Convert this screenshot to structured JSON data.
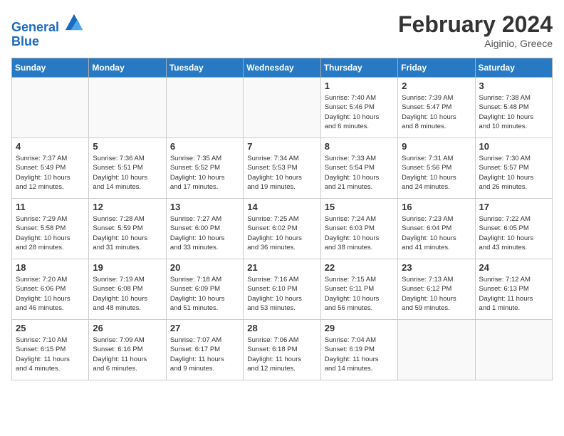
{
  "header": {
    "logo_line1": "General",
    "logo_line2": "Blue",
    "month_title": "February 2024",
    "location": "Aiginio, Greece"
  },
  "weekdays": [
    "Sunday",
    "Monday",
    "Tuesday",
    "Wednesday",
    "Thursday",
    "Friday",
    "Saturday"
  ],
  "weeks": [
    [
      {
        "day": "",
        "info": ""
      },
      {
        "day": "",
        "info": ""
      },
      {
        "day": "",
        "info": ""
      },
      {
        "day": "",
        "info": ""
      },
      {
        "day": "1",
        "info": "Sunrise: 7:40 AM\nSunset: 5:46 PM\nDaylight: 10 hours\nand 6 minutes."
      },
      {
        "day": "2",
        "info": "Sunrise: 7:39 AM\nSunset: 5:47 PM\nDaylight: 10 hours\nand 8 minutes."
      },
      {
        "day": "3",
        "info": "Sunrise: 7:38 AM\nSunset: 5:48 PM\nDaylight: 10 hours\nand 10 minutes."
      }
    ],
    [
      {
        "day": "4",
        "info": "Sunrise: 7:37 AM\nSunset: 5:49 PM\nDaylight: 10 hours\nand 12 minutes."
      },
      {
        "day": "5",
        "info": "Sunrise: 7:36 AM\nSunset: 5:51 PM\nDaylight: 10 hours\nand 14 minutes."
      },
      {
        "day": "6",
        "info": "Sunrise: 7:35 AM\nSunset: 5:52 PM\nDaylight: 10 hours\nand 17 minutes."
      },
      {
        "day": "7",
        "info": "Sunrise: 7:34 AM\nSunset: 5:53 PM\nDaylight: 10 hours\nand 19 minutes."
      },
      {
        "day": "8",
        "info": "Sunrise: 7:33 AM\nSunset: 5:54 PM\nDaylight: 10 hours\nand 21 minutes."
      },
      {
        "day": "9",
        "info": "Sunrise: 7:31 AM\nSunset: 5:56 PM\nDaylight: 10 hours\nand 24 minutes."
      },
      {
        "day": "10",
        "info": "Sunrise: 7:30 AM\nSunset: 5:57 PM\nDaylight: 10 hours\nand 26 minutes."
      }
    ],
    [
      {
        "day": "11",
        "info": "Sunrise: 7:29 AM\nSunset: 5:58 PM\nDaylight: 10 hours\nand 28 minutes."
      },
      {
        "day": "12",
        "info": "Sunrise: 7:28 AM\nSunset: 5:59 PM\nDaylight: 10 hours\nand 31 minutes."
      },
      {
        "day": "13",
        "info": "Sunrise: 7:27 AM\nSunset: 6:00 PM\nDaylight: 10 hours\nand 33 minutes."
      },
      {
        "day": "14",
        "info": "Sunrise: 7:25 AM\nSunset: 6:02 PM\nDaylight: 10 hours\nand 36 minutes."
      },
      {
        "day": "15",
        "info": "Sunrise: 7:24 AM\nSunset: 6:03 PM\nDaylight: 10 hours\nand 38 minutes."
      },
      {
        "day": "16",
        "info": "Sunrise: 7:23 AM\nSunset: 6:04 PM\nDaylight: 10 hours\nand 41 minutes."
      },
      {
        "day": "17",
        "info": "Sunrise: 7:22 AM\nSunset: 6:05 PM\nDaylight: 10 hours\nand 43 minutes."
      }
    ],
    [
      {
        "day": "18",
        "info": "Sunrise: 7:20 AM\nSunset: 6:06 PM\nDaylight: 10 hours\nand 46 minutes."
      },
      {
        "day": "19",
        "info": "Sunrise: 7:19 AM\nSunset: 6:08 PM\nDaylight: 10 hours\nand 48 minutes."
      },
      {
        "day": "20",
        "info": "Sunrise: 7:18 AM\nSunset: 6:09 PM\nDaylight: 10 hours\nand 51 minutes."
      },
      {
        "day": "21",
        "info": "Sunrise: 7:16 AM\nSunset: 6:10 PM\nDaylight: 10 hours\nand 53 minutes."
      },
      {
        "day": "22",
        "info": "Sunrise: 7:15 AM\nSunset: 6:11 PM\nDaylight: 10 hours\nand 56 minutes."
      },
      {
        "day": "23",
        "info": "Sunrise: 7:13 AM\nSunset: 6:12 PM\nDaylight: 10 hours\nand 59 minutes."
      },
      {
        "day": "24",
        "info": "Sunrise: 7:12 AM\nSunset: 6:13 PM\nDaylight: 11 hours\nand 1 minute."
      }
    ],
    [
      {
        "day": "25",
        "info": "Sunrise: 7:10 AM\nSunset: 6:15 PM\nDaylight: 11 hours\nand 4 minutes."
      },
      {
        "day": "26",
        "info": "Sunrise: 7:09 AM\nSunset: 6:16 PM\nDaylight: 11 hours\nand 6 minutes."
      },
      {
        "day": "27",
        "info": "Sunrise: 7:07 AM\nSunset: 6:17 PM\nDaylight: 11 hours\nand 9 minutes."
      },
      {
        "day": "28",
        "info": "Sunrise: 7:06 AM\nSunset: 6:18 PM\nDaylight: 11 hours\nand 12 minutes."
      },
      {
        "day": "29",
        "info": "Sunrise: 7:04 AM\nSunset: 6:19 PM\nDaylight: 11 hours\nand 14 minutes."
      },
      {
        "day": "",
        "info": ""
      },
      {
        "day": "",
        "info": ""
      }
    ]
  ]
}
